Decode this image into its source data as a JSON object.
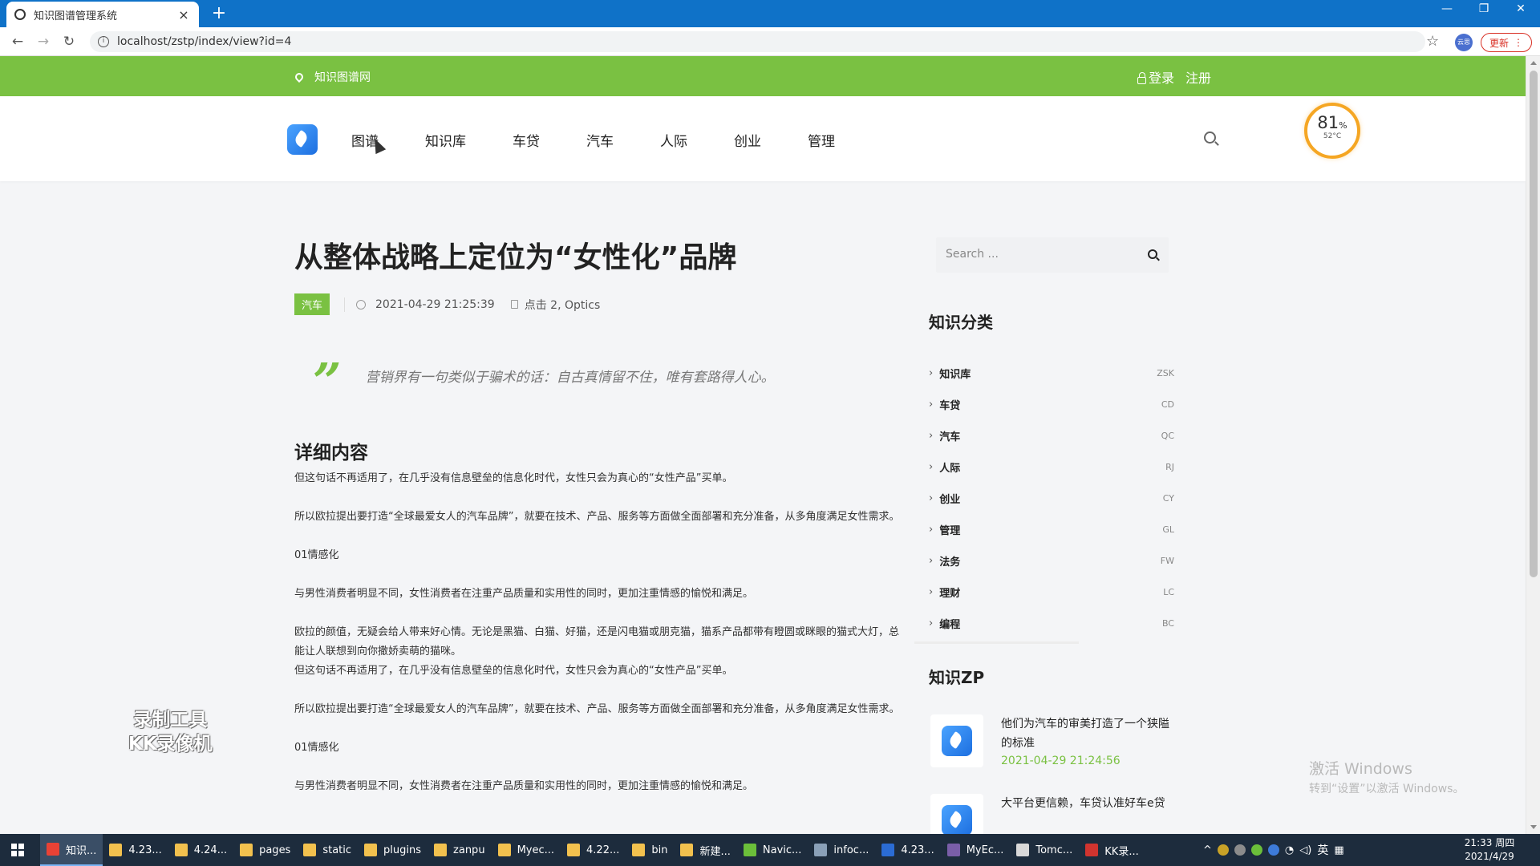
{
  "browser": {
    "tab_title": "知识图谱管理系统",
    "url": "localhost/zstp/index/view?id=4",
    "update_label": "更新",
    "profile_label": "云思",
    "new_tab_symbol": "+",
    "close_symbol": "×"
  },
  "site_bar": {
    "site_name": "知识图谱网",
    "login": "登录",
    "register": "注册"
  },
  "nav": {
    "items": [
      "图谱",
      "知识库",
      "车贷",
      "汽车",
      "人际",
      "创业",
      "管理"
    ]
  },
  "gauge": {
    "percent": "81",
    "percent_unit": "%",
    "temp": "52°C"
  },
  "article": {
    "title": "从整体战略上定位为“女性化”品牌",
    "tag": "汽车",
    "date": "2021-04-29 21:25:39",
    "clicks": "点击 2, Optics",
    "quote": "营销界有一句类似于骗术的话：自古真情留不住，唯有套路得人心。",
    "section_title": "详细内容",
    "paragraphs": [
      "但这句话不再适用了，在几乎没有信息壁垒的信息化时代，女性只会为真心的“女性产品”买单。",
      "所以欧拉提出要打造“全球最爱女人的汽车品牌”，就要在技术、产品、服务等方面做全面部署和充分准备，从多角度满足女性需求。",
      "01情感化",
      "与男性消费者明显不同，女性消费者在注重产品质量和实用性的同时，更加注重情感的愉悦和满足。",
      "欧拉的颜值，无疑会给人带来好心情。无论是黑猫、白猫、好猫，还是闪电猫或朋克猫，猫系产品都带有瞪圆或眯眼的猫式大灯，总能让人联想到向你撒娇卖萌的猫咪。",
      "但这句话不再适用了，在几乎没有信息壁垒的信息化时代，女性只会为真心的“女性产品”买单。",
      "所以欧拉提出要打造“全球最爱女人的汽车品牌”，就要在技术、产品、服务等方面做全面部署和充分准备，从多角度满足女性需求。",
      "01情感化",
      "与男性消费者明显不同，女性消费者在注重产品质量和实用性的同时，更加注重情感的愉悦和满足。"
    ]
  },
  "sidebar": {
    "search_placeholder": "Search ...",
    "categories_title": "知识分类",
    "categories": [
      {
        "name": "知识库",
        "code": "ZSK"
      },
      {
        "name": "车贷",
        "code": "CD"
      },
      {
        "name": "汽车",
        "code": "QC"
      },
      {
        "name": "人际",
        "code": "RJ"
      },
      {
        "name": "创业",
        "code": "CY"
      },
      {
        "name": "管理",
        "code": "GL"
      },
      {
        "name": "法务",
        "code": "FW"
      },
      {
        "name": "理财",
        "code": "LC"
      },
      {
        "name": "编程",
        "code": "BC"
      }
    ],
    "zp_title": "知识ZP",
    "posts": [
      {
        "title": "他们为汽车的审美打造了一个狭隘的标准",
        "date": "2021-04-29 21:24:56"
      },
      {
        "title": "大平台更信赖，车贷认准好车e贷",
        "date": ""
      }
    ]
  },
  "overlay": {
    "watermark_line1": "录制工具",
    "watermark_line2": "KK录像机",
    "activate_line1": "激活 Windows",
    "activate_line2": "转到“设置”以激活 Windows。"
  },
  "taskbar": {
    "items": [
      {
        "label": "知识...",
        "color": "#e94235"
      },
      {
        "label": "4.23...",
        "color": "#f2c14e"
      },
      {
        "label": "4.24...",
        "color": "#f2c14e"
      },
      {
        "label": "pages",
        "color": "#f2c14e"
      },
      {
        "label": "static",
        "color": "#f2c14e"
      },
      {
        "label": "plugins",
        "color": "#f2c14e"
      },
      {
        "label": "zanpu",
        "color": "#f2c14e"
      },
      {
        "label": "Myec...",
        "color": "#f2c14e"
      },
      {
        "label": "4.22...",
        "color": "#f2c14e"
      },
      {
        "label": "bin",
        "color": "#f2c14e"
      },
      {
        "label": "新建...",
        "color": "#f2c14e"
      },
      {
        "label": "Navic...",
        "color": "#6bbf3a"
      },
      {
        "label": "infoc...",
        "color": "#8aa0b8"
      },
      {
        "label": "4.23...",
        "color": "#2b6cd4"
      },
      {
        "label": "MyEc...",
        "color": "#7a5ea8"
      },
      {
        "label": "Tomc...",
        "color": "#d9d9d9"
      },
      {
        "label": "KK录...",
        "color": "#d1342f"
      }
    ],
    "lang": "英",
    "time": "21:33 周四",
    "date": "2021/4/29"
  },
  "colors": {
    "brand_green": "#7ac142",
    "tab_blue": "#0f72c8",
    "gauge_orange": "#f5a623"
  }
}
